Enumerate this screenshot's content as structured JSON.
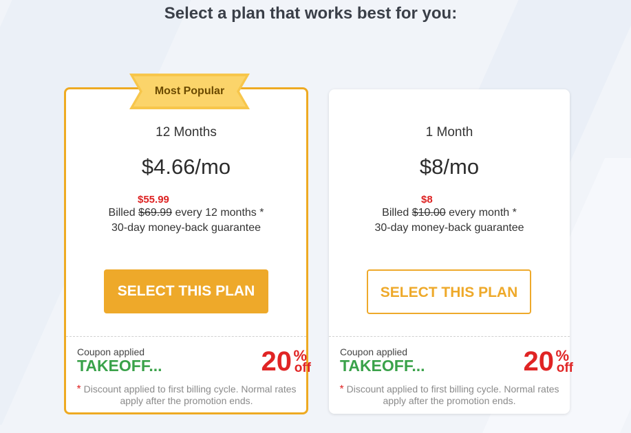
{
  "header": {
    "title": "Select a plan that works best for you:"
  },
  "colors": {
    "accent": "#eea92a",
    "discount_red": "#e02424",
    "coupon_green": "#3aa24a"
  },
  "plans": [
    {
      "badge": "Most Popular",
      "term": "12 Months",
      "price": "$4.66/mo",
      "sale_price": "$55.99",
      "billed_prefix": "Billed",
      "original_price": "$69.99",
      "billed_suffix": "every 12 months",
      "asterisk": "*",
      "guarantee": "30-day money-back guarantee",
      "button_label": "SELECT THIS PLAN",
      "coupon_label": "Coupon applied",
      "coupon_code": "TAKEOFF...",
      "discount_number": "20",
      "discount_percent": "%",
      "discount_off": "off",
      "disclaimer_star": "*",
      "disclaimer": "Discount applied to first billing cycle. Normal rates apply after the promotion ends."
    },
    {
      "term": "1 Month",
      "price": "$8/mo",
      "sale_price": "$8",
      "billed_prefix": "Billed",
      "original_price": "$10.00",
      "billed_suffix": "every month",
      "asterisk": "*",
      "guarantee": "30-day money-back guarantee",
      "button_label": "SELECT THIS PLAN",
      "coupon_label": "Coupon applied",
      "coupon_code": "TAKEOFF...",
      "discount_number": "20",
      "discount_percent": "%",
      "discount_off": "off",
      "disclaimer_star": "*",
      "disclaimer": "Discount applied to first billing cycle. Normal rates apply after the promotion ends."
    }
  ]
}
